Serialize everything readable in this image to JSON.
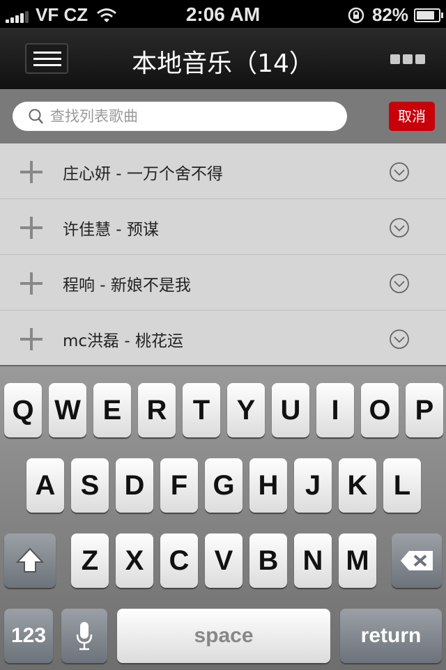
{
  "status": {
    "carrier": "VF CZ",
    "time": "2:06 AM",
    "battery": "82%",
    "battery_level": 0.82
  },
  "nav": {
    "title": "本地音乐（14）"
  },
  "search": {
    "placeholder": "查找列表歌曲",
    "cancel_label": "取消"
  },
  "songs": [
    {
      "title": "庄心妍 - 一万个舍不得"
    },
    {
      "title": "许佳慧 - 预谋"
    },
    {
      "title": "程响 - 新娘不是我"
    },
    {
      "title": "mc洪磊 - 桃花运"
    }
  ],
  "keyboard": {
    "row1": [
      "Q",
      "W",
      "E",
      "R",
      "T",
      "Y",
      "U",
      "I",
      "O",
      "P"
    ],
    "row2": [
      "A",
      "S",
      "D",
      "F",
      "G",
      "H",
      "J",
      "K",
      "L"
    ],
    "row3": [
      "Z",
      "X",
      "C",
      "V",
      "B",
      "N",
      "M"
    ],
    "numbers_label": "123",
    "space_label": "space",
    "return_label": "return"
  },
  "icons": {
    "menu": "menu-icon",
    "more": "more-icon",
    "search": "search-icon",
    "add": "plus-icon",
    "expand": "chevron-down-icon",
    "shift": "shift-icon",
    "delete": "backspace-icon",
    "mic": "microphone-icon",
    "lock": "rotation-lock-icon"
  },
  "colors": {
    "accent": "#c8000a",
    "nav_bg": "#111111"
  }
}
